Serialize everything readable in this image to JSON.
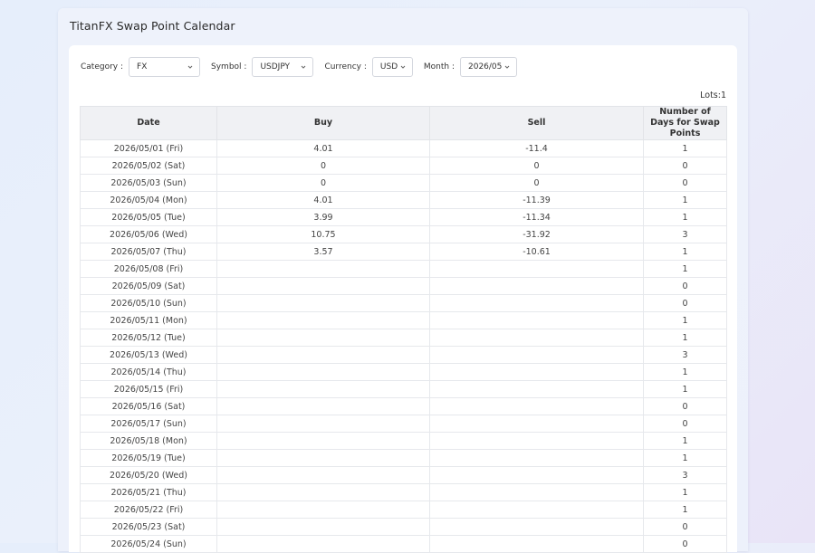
{
  "title": "TitanFX Swap Point Calendar",
  "filters": {
    "category_label": "Category :",
    "category_value": "FX",
    "symbol_label": "Symbol :",
    "symbol_value": "USDJPY",
    "currency_label": "Currency :",
    "currency_value": "USD",
    "month_label": "Month :",
    "month_value": "2026/05"
  },
  "lots": "Lots:1",
  "table": {
    "headers": [
      "Date",
      "Buy",
      "Sell",
      "Number of Days for Swap Points"
    ],
    "rows": [
      [
        "2026/05/01 (Fri)",
        "4.01",
        "-11.4",
        "1"
      ],
      [
        "2026/05/02 (Sat)",
        "0",
        "0",
        "0"
      ],
      [
        "2026/05/03 (Sun)",
        "0",
        "0",
        "0"
      ],
      [
        "2026/05/04 (Mon)",
        "4.01",
        "-11.39",
        "1"
      ],
      [
        "2026/05/05 (Tue)",
        "3.99",
        "-11.34",
        "1"
      ],
      [
        "2026/05/06 (Wed)",
        "10.75",
        "-31.92",
        "3"
      ],
      [
        "2026/05/07 (Thu)",
        "3.57",
        "-10.61",
        "1"
      ],
      [
        "2026/05/08 (Fri)",
        "",
        "",
        "1"
      ],
      [
        "2026/05/09 (Sat)",
        "",
        "",
        "0"
      ],
      [
        "2026/05/10 (Sun)",
        "",
        "",
        "0"
      ],
      [
        "2026/05/11 (Mon)",
        "",
        "",
        "1"
      ],
      [
        "2026/05/12 (Tue)",
        "",
        "",
        "1"
      ],
      [
        "2026/05/13 (Wed)",
        "",
        "",
        "3"
      ],
      [
        "2026/05/14 (Thu)",
        "",
        "",
        "1"
      ],
      [
        "2026/05/15 (Fri)",
        "",
        "",
        "1"
      ],
      [
        "2026/05/16 (Sat)",
        "",
        "",
        "0"
      ],
      [
        "2026/05/17 (Sun)",
        "",
        "",
        "0"
      ],
      [
        "2026/05/18 (Mon)",
        "",
        "",
        "1"
      ],
      [
        "2026/05/19 (Tue)",
        "",
        "",
        "1"
      ],
      [
        "2026/05/20 (Wed)",
        "",
        "",
        "3"
      ],
      [
        "2026/05/21 (Thu)",
        "",
        "",
        "1"
      ],
      [
        "2026/05/22 (Fri)",
        "",
        "",
        "1"
      ],
      [
        "2026/05/23 (Sat)",
        "",
        "",
        "0"
      ],
      [
        "2026/05/24 (Sun)",
        "",
        "",
        "0"
      ]
    ]
  },
  "icons": {
    "select_chevron": "chevron-down-icon"
  }
}
